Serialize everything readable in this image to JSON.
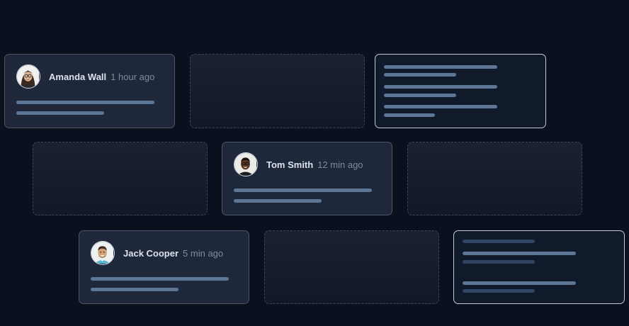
{
  "comments": [
    {
      "name": "Amanda Wall",
      "time": "1 hour ago",
      "avatar": "woman-with-glasses"
    },
    {
      "name": "Tom Smith",
      "time": "12 min ago",
      "avatar": "man-with-glasses"
    },
    {
      "name": "Jack Cooper",
      "time": "5 min ago",
      "avatar": "smiling-man"
    }
  ],
  "colors": {
    "background": "#0a101d",
    "card": "#1e283a",
    "line": "#5d7696"
  }
}
